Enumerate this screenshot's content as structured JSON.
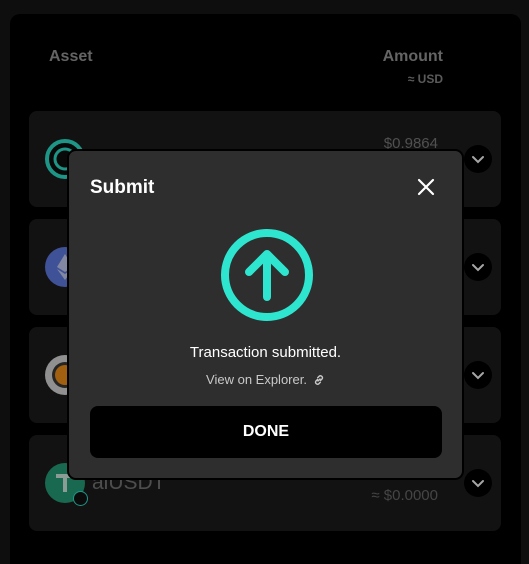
{
  "table": {
    "header_asset": "Asset",
    "header_amount": "Amount",
    "header_amount_sub": "≈ USD"
  },
  "rows": [
    {
      "coin_icon": "stablecoin-icon",
      "name": "",
      "amount": "$0.9864",
      "usd": "",
      "color": "#2ee6d0"
    },
    {
      "coin_icon": "eth-icon",
      "name": "",
      "amount": "",
      "usd": "",
      "color": "#627eea"
    },
    {
      "coin_icon": "btc-icon",
      "name": "",
      "amount": "",
      "usd": "",
      "color": "#f7931a"
    },
    {
      "coin_icon": "usdt-icon",
      "name": "alUSDT",
      "amount": "",
      "usd": "≈ $0.0000",
      "color": "#26a17b"
    }
  ],
  "modal": {
    "title": "Submit",
    "status_icon": "arrow-up-circle-icon",
    "status_text": "Transaction submitted.",
    "explorer_link": "View on Explorer.",
    "done_label": "DONE",
    "accent": "#2ee6d0"
  }
}
